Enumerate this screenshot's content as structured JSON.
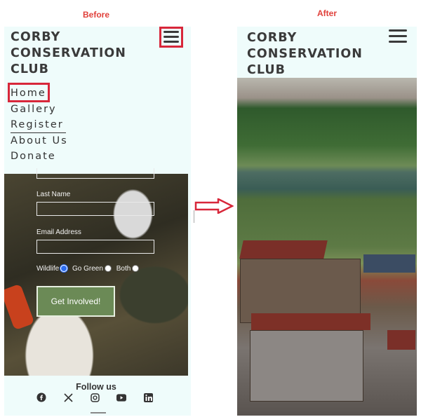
{
  "captions": {
    "before": "Before",
    "after": "After"
  },
  "brand": {
    "line1": "CORBY",
    "line2": "CONSERVATION",
    "line3": "CLUB"
  },
  "nav": {
    "home": "Home",
    "gallery": "Gallery",
    "register": "Register",
    "about": "About Us",
    "donate": "Donate"
  },
  "form": {
    "last_name_label": "Last Name",
    "email_label": "Email Address",
    "radio_wildlife": "Wildlife",
    "radio_go_green": "Go Green",
    "radio_both": "Both",
    "selected_option": "Wildlife",
    "cta": "Get Involved!"
  },
  "footer": {
    "follow_us": "Follow us",
    "icons": [
      "facebook-icon",
      "x-icon",
      "instagram-icon",
      "youtube-icon",
      "linkedin-icon"
    ]
  },
  "highlight_color": "#d8273a",
  "background_color": "#effcfb"
}
